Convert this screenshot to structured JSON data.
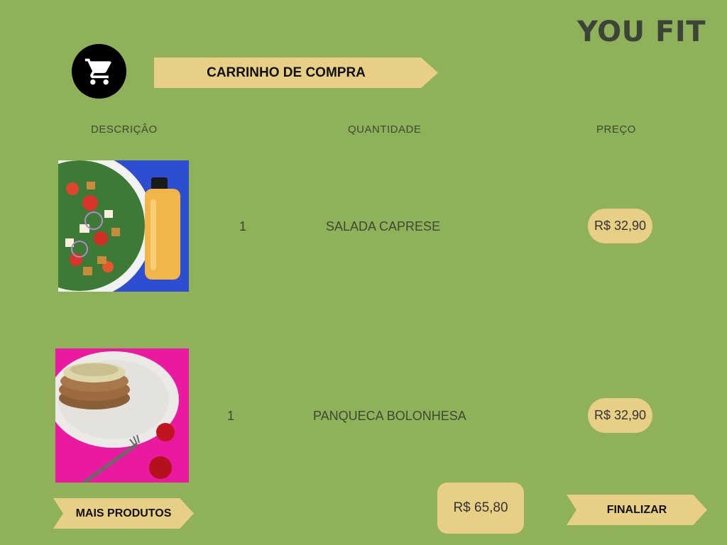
{
  "brand": "YOU FIT",
  "header": {
    "title": "CARRINHO DE COMPRA",
    "icon": "shopping-cart-icon"
  },
  "columns": {
    "description": "DESCRIÇÂO",
    "quantity": "QUANTIDADE",
    "price": "PREÇO"
  },
  "items": [
    {
      "image": "salad-and-juice-photo",
      "quantity": "1",
      "name": "SALADA CAPRESE",
      "price": "R$ 32,90"
    },
    {
      "image": "pancake-bolognese-photo",
      "quantity": "1",
      "name": "PANQUECA BOLONHESA",
      "price": "R$ 32,90"
    }
  ],
  "footer": {
    "more_products": "MAIS PRODUTOS",
    "total": "R$ 65,80",
    "finalize": "FINALIZAR"
  },
  "colors": {
    "background": "#8fb15a",
    "accent": "#e8cf86",
    "text_dark": "#3a4a33"
  }
}
